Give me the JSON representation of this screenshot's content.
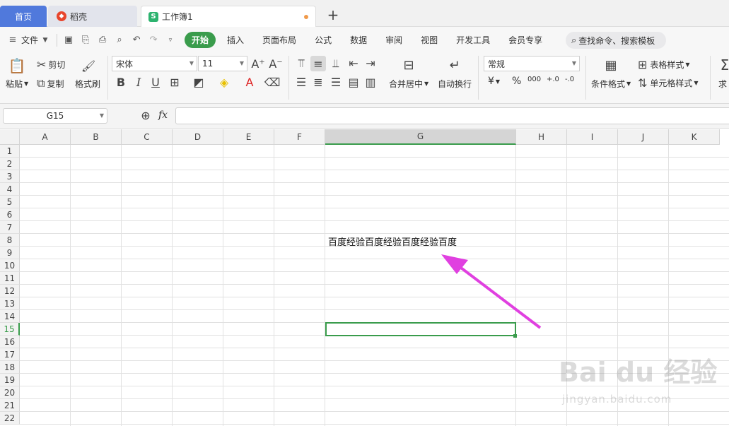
{
  "tabs": {
    "home": "首页",
    "daoke": "稻壳",
    "workbook": "工作簿1",
    "add": "+"
  },
  "menu": {
    "file": "文件",
    "items": [
      "开始",
      "插入",
      "页面布局",
      "公式",
      "数据",
      "审阅",
      "视图",
      "开发工具",
      "会员专享"
    ],
    "search": "查找命令、搜索模板"
  },
  "ribbon": {
    "paste": "粘贴",
    "cut": "剪切",
    "copy": "复制",
    "format_painter": "格式刷",
    "font_name": "宋体",
    "font_size": "11",
    "merge_center": "合并居中",
    "wrap_text": "自动换行",
    "number_format": "常规",
    "currency": "¥",
    "percent": "%",
    "thousands": "000",
    "dec_inc": "+.0",
    "dec_dec": "-.0",
    "cond_format": "条件格式",
    "table_style": "表格样式",
    "cell_style": "单元格样式",
    "sum": "求"
  },
  "formula_bar": {
    "name_box": "G15",
    "fx": "fx",
    "value": ""
  },
  "sheet": {
    "columns": [
      "A",
      "B",
      "C",
      "D",
      "E",
      "F",
      "G",
      "H",
      "I",
      "J",
      "K"
    ],
    "selected_column": "G",
    "rows": [
      "1",
      "2",
      "3",
      "4",
      "5",
      "6",
      "7",
      "8",
      "9",
      "10",
      "11",
      "12",
      "13",
      "14",
      "15",
      "16",
      "17",
      "18",
      "19",
      "20",
      "21",
      "22"
    ],
    "selected_row": "15",
    "cell_g8": "百度经验百度经验百度经验百度"
  },
  "watermark": {
    "brand": "Bai du 经验",
    "url": "jingyan.baidu.com"
  },
  "colors": {
    "accent_green": "#3a9c4c",
    "home_tab": "#5079dc",
    "annotation_arrow": "#e040e0"
  }
}
